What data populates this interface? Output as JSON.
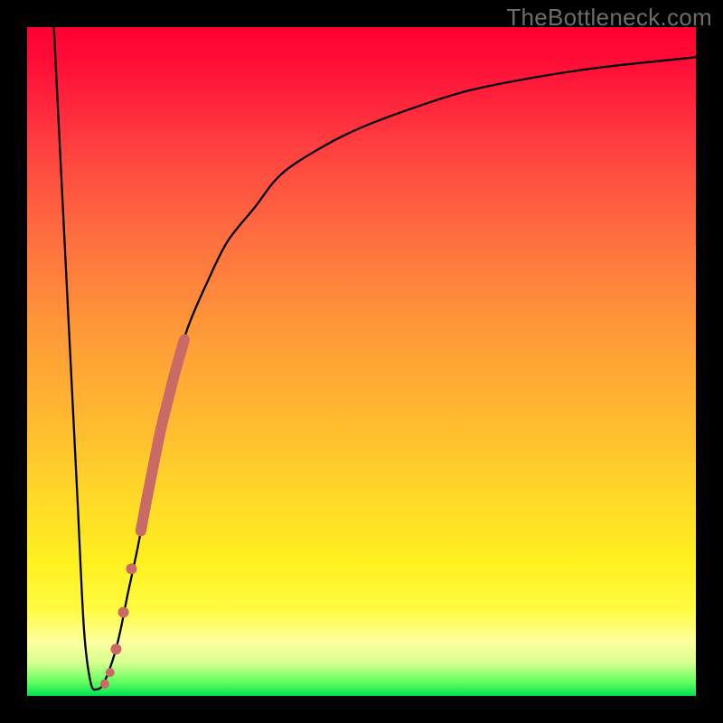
{
  "watermark": "TheBottleneck.com",
  "chart_data": {
    "type": "line",
    "title": "",
    "xlabel": "",
    "ylabel": "",
    "xlim": [
      0,
      100
    ],
    "ylim": [
      0,
      100
    ],
    "grid": false,
    "series": [
      {
        "name": "bottleneck-curve",
        "x": [
          4,
          6,
          7.5,
          8.5,
          9.5,
          10.5,
          11.5,
          13,
          14,
          15,
          16.5,
          18,
          20,
          22,
          24,
          27,
          30,
          34,
          38,
          44,
          50,
          58,
          66,
          76,
          86,
          100
        ],
        "y": [
          100,
          60,
          30,
          10,
          2,
          1,
          2,
          6,
          10,
          15,
          22,
          30,
          40,
          48,
          55,
          62,
          68,
          73,
          78,
          82,
          85,
          88,
          90.5,
          92.5,
          94,
          95.5
        ]
      }
    ],
    "markers": [
      {
        "name": "segment-thick",
        "x_range": [
          17,
          23.5
        ],
        "stroke_width": 12,
        "color": "#c96a66"
      },
      {
        "name": "dot-1",
        "x": 15.6,
        "y": 19.0,
        "r": 6,
        "color": "#c96a66"
      },
      {
        "name": "dot-2",
        "x": 14.4,
        "y": 12.5,
        "r": 6,
        "color": "#c96a66"
      },
      {
        "name": "dot-3",
        "x": 13.3,
        "y": 7.0,
        "r": 6,
        "color": "#c96a66"
      },
      {
        "name": "dot-4",
        "x": 12.4,
        "y": 3.5,
        "r": 5,
        "color": "#c96a66"
      },
      {
        "name": "dot-5",
        "x": 11.6,
        "y": 1.8,
        "r": 5,
        "color": "#c96a66"
      }
    ]
  }
}
